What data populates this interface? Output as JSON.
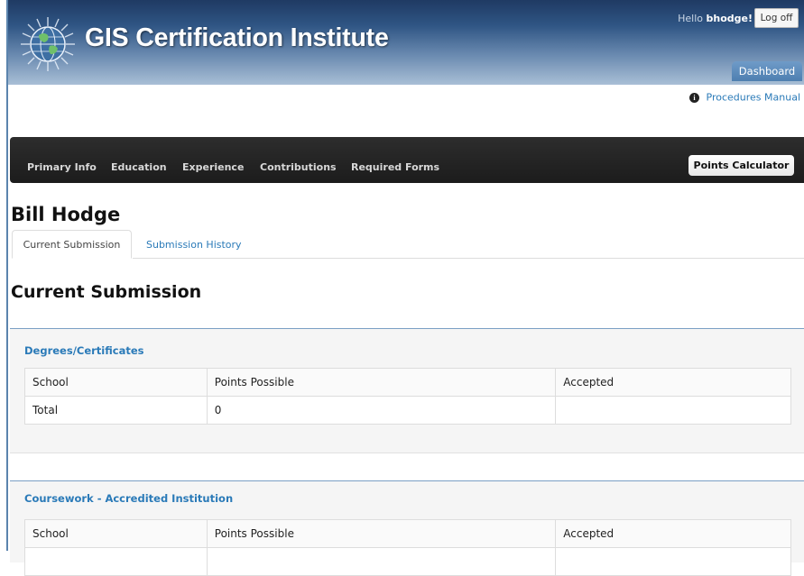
{
  "header": {
    "site_title": "GIS Certification Institute",
    "greeting_prefix": "Hello",
    "username": "bhodge!",
    "logoff_label": "Log off",
    "dashboard_label": "Dashboard"
  },
  "procedures": {
    "icon": "info-circle-icon",
    "label": "Procedures Manual"
  },
  "nav": {
    "items": [
      {
        "label": "Primary Info"
      },
      {
        "label": "Education"
      },
      {
        "label": "Experience"
      },
      {
        "label": "Contributions"
      },
      {
        "label": "Required Forms"
      }
    ],
    "points_calculator_label": "Points Calculator"
  },
  "person": {
    "name": "Bill Hodge"
  },
  "tabs": [
    {
      "label": "Current Submission",
      "active": true
    },
    {
      "label": "Submission History",
      "active": false
    }
  ],
  "section_title": "Current Submission",
  "panels": [
    {
      "title": "Degrees/Certificates",
      "columns": [
        "School",
        "Points Possible",
        "Accepted"
      ],
      "total_label": "Total",
      "total_points": "0",
      "total_accepted": ""
    },
    {
      "title": "Coursework - Accredited Institution",
      "columns": [
        "School",
        "Points Possible",
        "Accepted"
      ]
    }
  ],
  "colors": {
    "accent_link": "#2a7ab8",
    "navbar_bg": "#222222",
    "header_top": "#1f3a63",
    "header_bottom": "#a9bfd6",
    "panel_border": "#7a9fc4"
  }
}
